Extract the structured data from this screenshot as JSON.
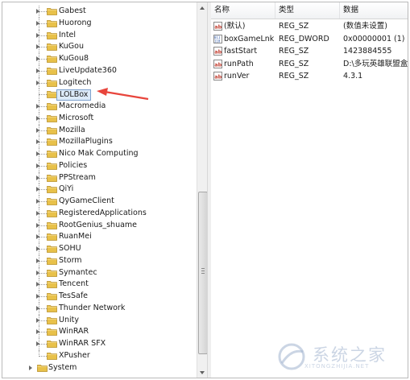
{
  "tree": {
    "items": [
      {
        "label": "Gabest",
        "expandable": true
      },
      {
        "label": "Huorong",
        "expandable": true
      },
      {
        "label": "Intel",
        "expandable": true
      },
      {
        "label": "KuGou",
        "expandable": true
      },
      {
        "label": "KuGou8",
        "expandable": true
      },
      {
        "label": "LiveUpdate360",
        "expandable": true
      },
      {
        "label": "Logitech",
        "expandable": true
      },
      {
        "label": "LOLBox",
        "expandable": false,
        "selected": true
      },
      {
        "label": "Macromedia",
        "expandable": true
      },
      {
        "label": "Microsoft",
        "expandable": true
      },
      {
        "label": "Mozilla",
        "expandable": true
      },
      {
        "label": "MozillaPlugins",
        "expandable": true
      },
      {
        "label": "Nico Mak Computing",
        "expandable": true
      },
      {
        "label": "Policies",
        "expandable": true
      },
      {
        "label": "PPStream",
        "expandable": true
      },
      {
        "label": "QiYi",
        "expandable": true
      },
      {
        "label": "QyGameClient",
        "expandable": true
      },
      {
        "label": "RegisteredApplications",
        "expandable": true
      },
      {
        "label": "RootGenius_shuame",
        "expandable": true
      },
      {
        "label": "RuanMei",
        "expandable": true
      },
      {
        "label": "SOHU",
        "expandable": true
      },
      {
        "label": "Storm",
        "expandable": true
      },
      {
        "label": "Symantec",
        "expandable": true
      },
      {
        "label": "Tencent",
        "expandable": true
      },
      {
        "label": "TesSafe",
        "expandable": true
      },
      {
        "label": "Thunder Network",
        "expandable": true
      },
      {
        "label": "Unity",
        "expandable": true
      },
      {
        "label": "WinRAR",
        "expandable": true
      },
      {
        "label": "WinRAR SFX",
        "expandable": true
      },
      {
        "label": "XPusher",
        "expandable": false,
        "last": true
      },
      {
        "label": "System",
        "expandable": true,
        "root": true
      }
    ]
  },
  "values": {
    "headers": {
      "name": "名称",
      "type": "类型",
      "data": "数据"
    },
    "rows": [
      {
        "name": "(默认)",
        "type": "REG_SZ",
        "data": "(数值未设置)",
        "icon": "string-value-icon"
      },
      {
        "name": "boxGameLnk...",
        "type": "REG_DWORD",
        "data": "0x00000001 (1)",
        "icon": "dword-value-icon"
      },
      {
        "name": "fastStart",
        "type": "REG_SZ",
        "data": "1423884555",
        "icon": "string-value-icon"
      },
      {
        "name": "runPath",
        "type": "REG_SZ",
        "data": "D:\\多玩英雄联盟盒子",
        "icon": "string-value-icon"
      },
      {
        "name": "runVer",
        "type": "REG_SZ",
        "data": "4.3.1",
        "icon": "string-value-icon"
      }
    ]
  },
  "watermark": {
    "title": "系统之家",
    "subtitle": "XITONGZHIJIA.NET"
  },
  "colors": {
    "folder": "#e8c14a",
    "selection": "#dceaf8",
    "arrow": "#e8453c"
  }
}
